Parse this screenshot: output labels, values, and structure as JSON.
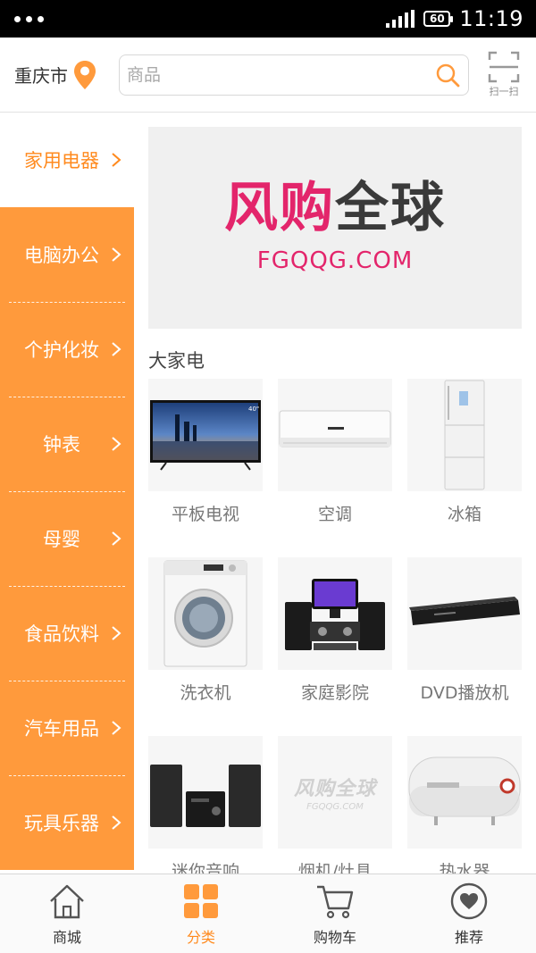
{
  "status_bar": {
    "battery": "60",
    "time": "11:19"
  },
  "header": {
    "city": "重庆市",
    "search_placeholder": "商品",
    "scan_label": "扫一扫"
  },
  "sidebar": {
    "items": [
      {
        "label": "家用电器",
        "active": true
      },
      {
        "label": "电脑办公"
      },
      {
        "label": "个护化妆"
      },
      {
        "label": "钟表"
      },
      {
        "label": "母婴"
      },
      {
        "label": "食品饮料"
      },
      {
        "label": "汽车用品"
      },
      {
        "label": "玩具乐器"
      }
    ]
  },
  "banner": {
    "title_part1": "风购",
    "title_part2": "全球",
    "subtitle": "FGQQG.COM"
  },
  "section": {
    "title": "大家电"
  },
  "products": [
    {
      "name": "平板电视",
      "icon": "tv-image"
    },
    {
      "name": "空调",
      "icon": "air-conditioner-image"
    },
    {
      "name": "冰箱",
      "icon": "refrigerator-image"
    },
    {
      "name": "洗衣机",
      "icon": "washing-machine-image"
    },
    {
      "name": "家庭影院",
      "icon": "home-theater-image"
    },
    {
      "name": "DVD播放机",
      "icon": "dvd-player-image"
    },
    {
      "name": "迷你音响",
      "icon": "mini-speaker-image"
    },
    {
      "name": "烟机/灶具",
      "icon": "placeholder-logo-image",
      "logo_text": "风购全球",
      "logo_sub": "FGQQG.COM"
    },
    {
      "name": "热水器",
      "icon": "water-heater-image"
    }
  ],
  "tabbar": {
    "tabs": [
      {
        "label": "商城",
        "icon": "home-icon"
      },
      {
        "label": "分类",
        "icon": "category-grid-icon",
        "active": true
      },
      {
        "label": "购物车",
        "icon": "cart-icon"
      },
      {
        "label": "推荐",
        "icon": "heart-icon"
      }
    ]
  },
  "colors": {
    "accent": "#ff9a3c",
    "accent_text": "#ff8a1e",
    "brand_pink": "#e3256b"
  }
}
